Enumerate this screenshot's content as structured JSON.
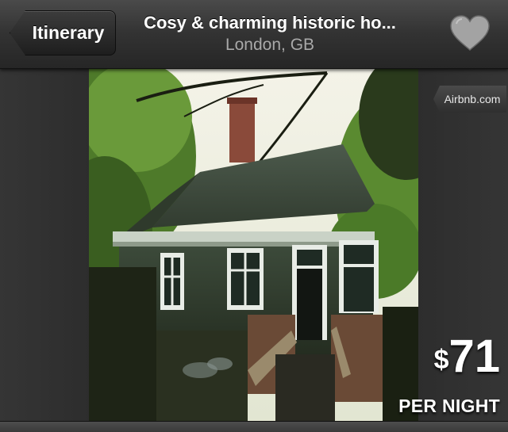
{
  "navbar": {
    "back_label": "Itinerary",
    "title": "Cosy & charming historic ho...",
    "subtitle": "London, GB",
    "favorite_icon": "heart-icon"
  },
  "listing": {
    "photo_icon": "house-photo",
    "source_badge": "Airbnb.com",
    "price_currency": "$",
    "price_amount": "71",
    "price_unit": "PER NIGHT"
  },
  "colors": {
    "navbar": "#333333",
    "heart": "#a3a3a3",
    "text": "#ffffff",
    "subtitle": "#a9a9a9"
  }
}
